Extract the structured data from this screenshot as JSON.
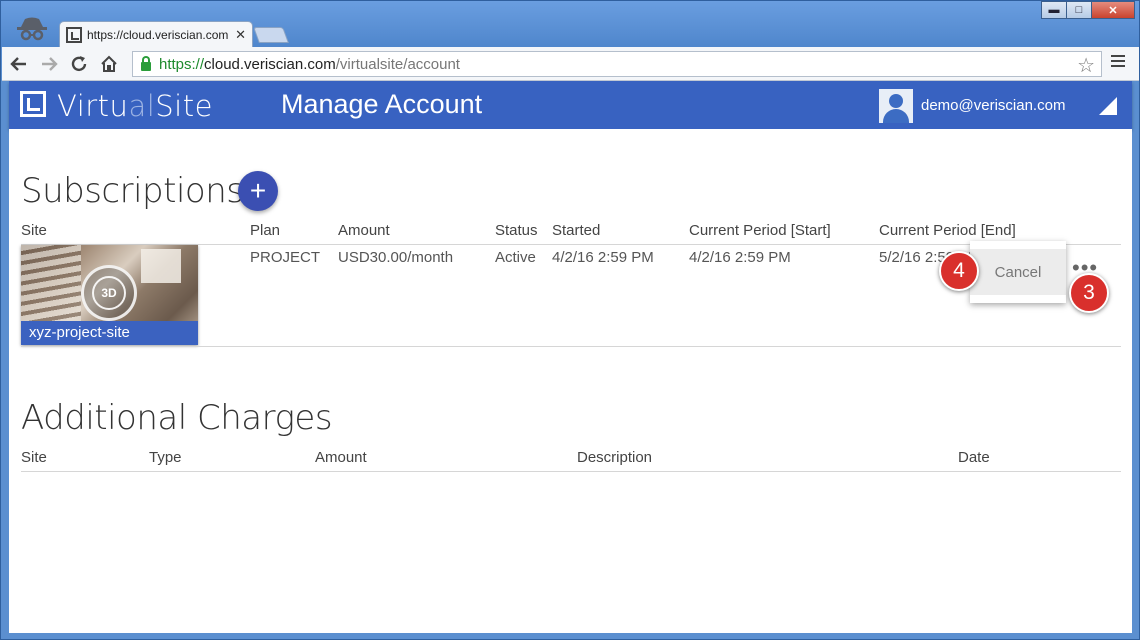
{
  "browser": {
    "tab_title": "https://cloud.veriscian.com",
    "url_scheme": "https://",
    "url_host": "cloud.veriscian.com",
    "url_path": "/virtualsite/account",
    "window_controls": {
      "minimize": "▬",
      "maximize": "□",
      "close": "✕"
    }
  },
  "header": {
    "logo_a": "Virtu",
    "logo_b": "al",
    "logo_c": "Site",
    "title": "Manage Account",
    "user_email": "demo@veriscian.com"
  },
  "subscriptions": {
    "title": "Subscriptions",
    "add_label": "+",
    "columns": [
      "Site",
      "Plan",
      "Amount",
      "Status",
      "Started",
      "Current Period [Start]",
      "Current Period [End]"
    ],
    "rows": [
      {
        "site": "xyz-project-site",
        "thumb_badge": "3D",
        "plan": "PROJECT",
        "amount": "USD30.00/month",
        "status": "Active",
        "started": "4/2/16 2:59 PM",
        "period_start": "4/2/16 2:59 PM",
        "period_end": "5/2/16 2:59 PM"
      }
    ],
    "menu_label": "•••",
    "popup_option": "Cancel"
  },
  "additional_charges": {
    "title": "Additional Charges",
    "columns": [
      "Site",
      "Type",
      "Amount",
      "Description",
      "Date"
    ]
  },
  "callouts": [
    "4",
    "3"
  ],
  "colors": {
    "header_blue": "#3862c1",
    "add_button": "#3b4fb2",
    "callout_red": "#d9302c"
  }
}
